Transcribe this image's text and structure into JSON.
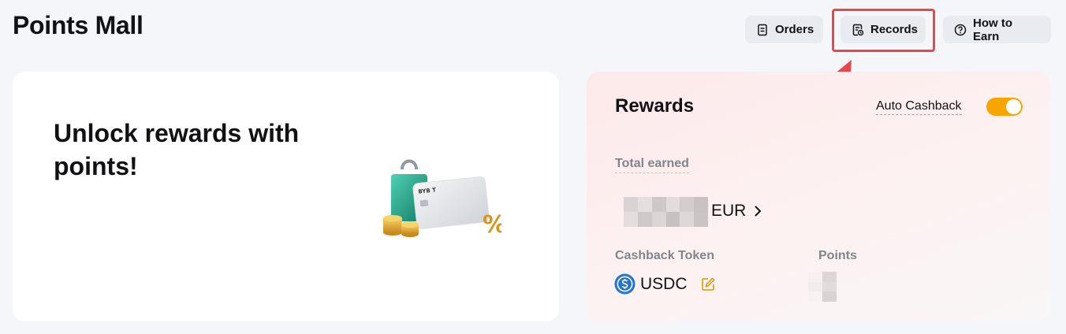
{
  "page": {
    "title": "Points Mall"
  },
  "header": {
    "orders_label": "Orders",
    "records_label": "Records",
    "how_to_earn_label": "How to Earn"
  },
  "promo": {
    "heading": "Unlock rewards with points!",
    "card_brand_text": "BYB T"
  },
  "rewards": {
    "title": "Rewards",
    "auto_cashback_label": "Auto Cashback",
    "auto_cashback_on": true,
    "total_earned_label": "Total earned",
    "currency": "EUR",
    "cashback_token_label": "Cashback Token",
    "cashback_token": "USDC",
    "points_label": "Points"
  },
  "colors": {
    "accent": "#f7a600",
    "highlight": "#e8474b",
    "usdc": "#2775ca"
  },
  "icons": {
    "orders": "document-list-icon",
    "records": "records-clock-icon",
    "how_to_earn": "question-circle-icon",
    "currency_link": "chevron-right-icon",
    "token": "usdc-icon",
    "edit": "edit-icon"
  }
}
